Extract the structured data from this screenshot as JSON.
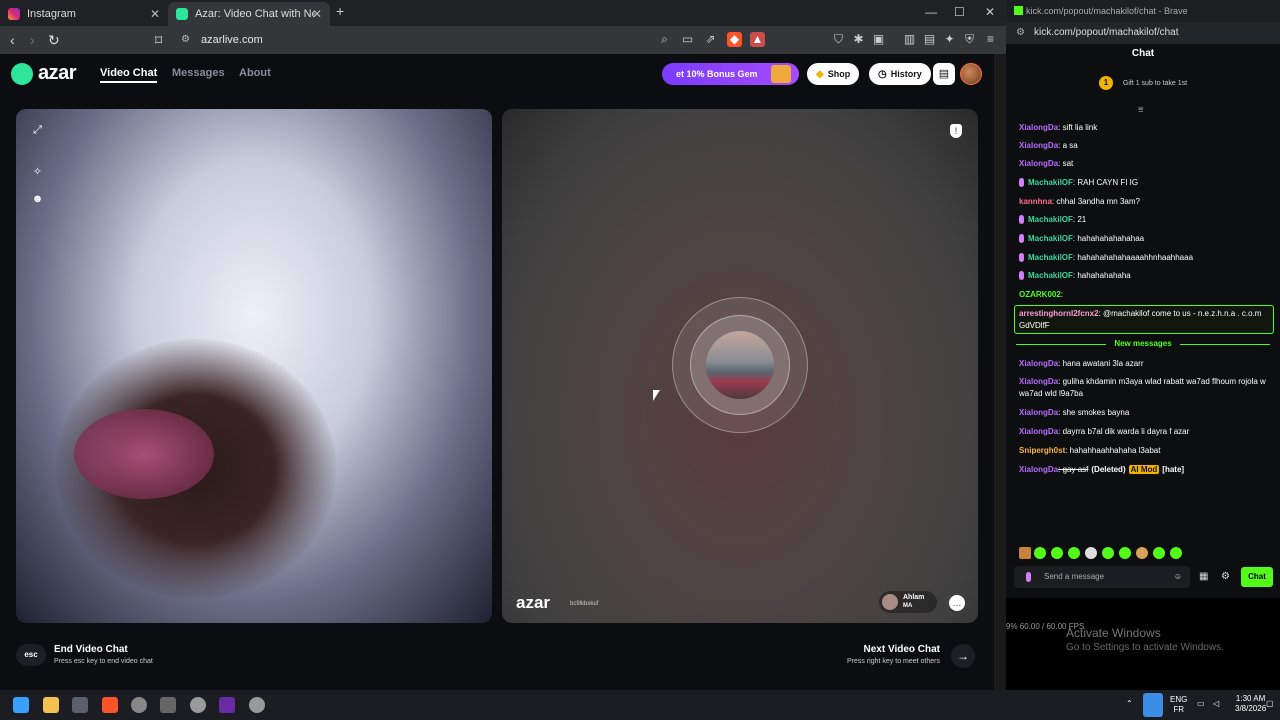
{
  "browser": {
    "tabs": [
      {
        "title": "Instagram",
        "icon": "instagram-icon"
      },
      {
        "title": "Azar: Video Chat with New Pe",
        "icon": "azar-icon"
      }
    ],
    "url": "azarlive.com"
  },
  "azar": {
    "logo": "azar",
    "nav": [
      "Video Chat",
      "Messages",
      "About"
    ],
    "promo_label": "et 10% Bonus Gem",
    "shop_label": "Shop",
    "history_label": "History",
    "watermark": "azar",
    "watermark_id": "bc9lkbxkuf",
    "peer_name": "Ahlam",
    "peer_country": "MA",
    "end_title": "End Video Chat",
    "end_sub": "Press esc key to end video chat",
    "esc_label": "esc",
    "next_title": "Next Video Chat",
    "next_sub": "Press right key to meet others"
  },
  "kick": {
    "window_title": "kick.com/popout/machakilof/chat - Brave",
    "url": "kick.com/popout/machakilof/chat",
    "header": "Chat",
    "gift_text": "Gift 1 sub to take 1st",
    "gift_badge": "1",
    "new_messages_label": "New messages",
    "messages": [
      {
        "user": "XialongDa",
        "text": ": sift lia link",
        "color": "#b76bff",
        "mic": false
      },
      {
        "user": "XialongDa",
        "text": ": a sa",
        "color": "#b76bff",
        "mic": false
      },
      {
        "user": "XialongDa",
        "text": ": sat",
        "color": "#b76bff",
        "mic": false
      },
      {
        "user": "MachakilOF",
        "text": ": RAH CAYN FI IG",
        "color": "#3cd6a0",
        "mic": true
      },
      {
        "user": "kannhna",
        "text": ": chhal 3andha mn 3am?",
        "color": "#ff6b8a",
        "mic": false
      },
      {
        "user": "MachakilOF",
        "text": ": 21",
        "color": "#3cd6a0",
        "mic": true
      },
      {
        "user": "MachakilOF",
        "text": ": hahahahahahahaa",
        "color": "#3cd6a0",
        "mic": true
      },
      {
        "user": "MachakilOF",
        "text": ": hahahahahahaaaahhnhaahhaaa",
        "color": "#3cd6a0",
        "mic": true
      },
      {
        "user": "MachakilOF",
        "text": ": hahahahahaha",
        "color": "#3cd6a0",
        "mic": true
      },
      {
        "user": "OZARK002",
        "text": ":",
        "color": "#53fc18",
        "mic": false
      },
      {
        "user": "arrestinghornl2fcnx2",
        "text": ": @machakilof come to us - n.e.z.h.n.a . c.o.m GdVDlfF",
        "color": "#ff9ad5",
        "mic": false
      },
      {
        "user": "XialongDa",
        "text": ": hana awatani 3la azarr",
        "color": "#b76bff",
        "mic": false
      },
      {
        "user": "XialongDa",
        "text": ": guliha khdamin m3aya wlad rabatt wa7ad flhoum rojola w wa7ad wld l9a7ba",
        "color": "#b76bff",
        "mic": false
      },
      {
        "user": "XialongDa",
        "text": ": she smokes bayna",
        "color": "#b76bff",
        "mic": false
      },
      {
        "user": "XialongDa",
        "text": ": dayrra b7al dik warda li dayra f azar",
        "color": "#b76bff",
        "mic": false
      },
      {
        "user": "Snipergh0st",
        "text": ": hahahhaahhahaha l3abat",
        "color": "#ffb347",
        "mic": false
      },
      {
        "user": "XialongDa",
        "text": ": gay asf",
        "color": "#b76bff",
        "mic": false,
        "deleted": "(Deleted)",
        "mod": "AI Mod",
        "tag": "[hate]"
      }
    ],
    "input_placeholder": "Send a message",
    "chat_button": "Chat",
    "fps_text": "9%   60.00 / 60.00 FPS"
  },
  "system": {
    "activate_title": "Activate Windows",
    "activate_sub": "Go to Settings to activate Windows.",
    "lang_top": "ENG",
    "lang_bottom": "FR",
    "time": "1:30 AM",
    "date": "3/8/2026"
  },
  "colors": {
    "accent_green": "#53fc18",
    "azar_green": "#2ee69a",
    "promo_purple": "#8a3cff"
  }
}
